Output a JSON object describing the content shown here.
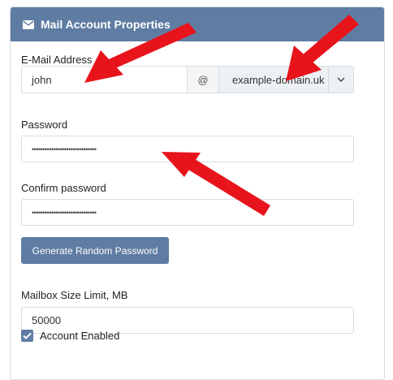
{
  "header": {
    "title": "Mail Account Properties",
    "icon": "envelope-icon"
  },
  "email": {
    "label": "E-Mail Address",
    "user_value": "john",
    "at_symbol": "@",
    "domain_value": "example-domain.uk"
  },
  "password": {
    "label": "Password",
    "masked_value": "••••••••••••••••••••••••••••••"
  },
  "confirm_password": {
    "label": "Confirm password",
    "masked_value": "••••••••••••••••••••••••••••••"
  },
  "generate_button": {
    "label": "Generate Random Password"
  },
  "mailbox_limit": {
    "label": "Mailbox Size Limit, MB",
    "value": "50000"
  },
  "account_enabled": {
    "label": "Account Enabled",
    "checked": true
  },
  "colors": {
    "accent": "#5f7ca3",
    "arrow": "#e8141b"
  }
}
